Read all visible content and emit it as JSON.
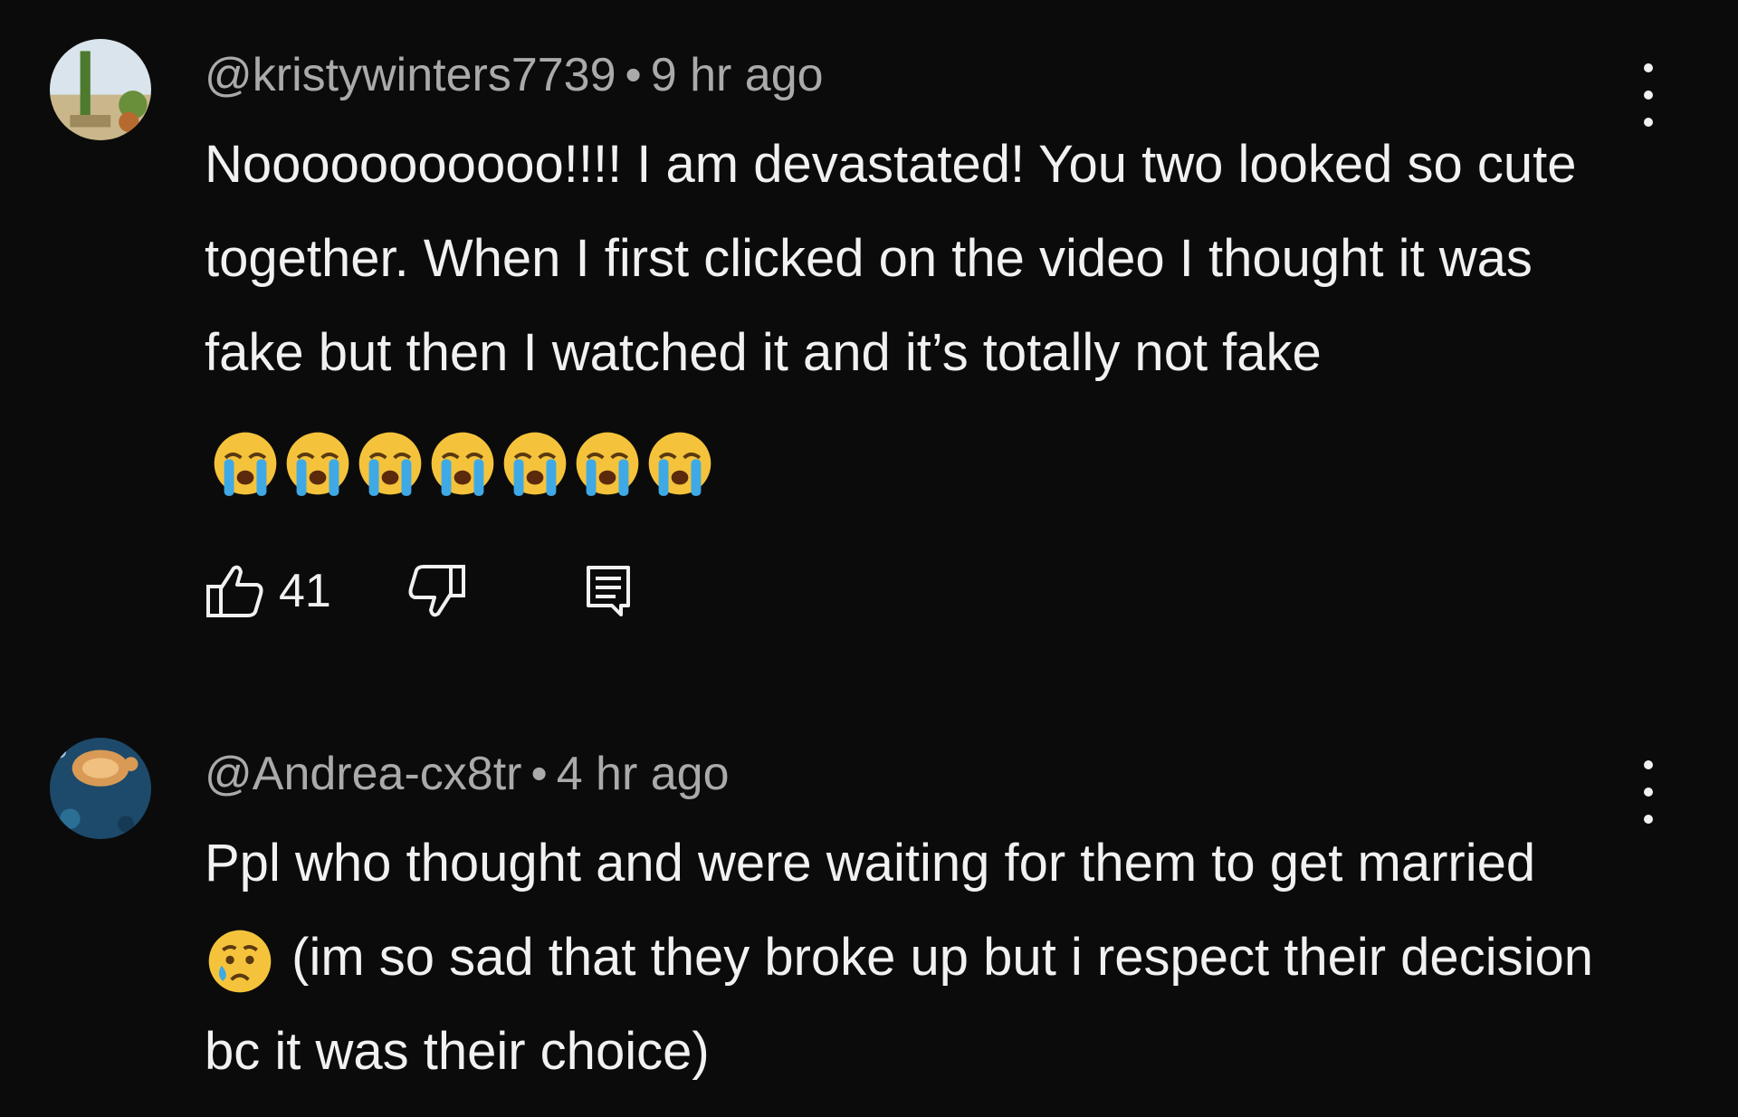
{
  "comments": [
    {
      "author": "@kristywinters7739",
      "separator": "•",
      "time": "9 hr ago",
      "text": "Nooooooooooo!!!! I am devastated! You two looked so cute together. When I first clicked on the video I thought it was fake but then I watched it and it’s totally not fake",
      "emoji": "loudly-crying-face",
      "emoji_count": 7,
      "likes": "41",
      "avatar_icon": "desert-landscape-avatar",
      "menu_icon": "more-vertical-icon"
    },
    {
      "author": "@Andrea-cx8tr",
      "separator": "•",
      "time": "4 hr ago",
      "text_before_emoji": "Ppl who thought and were waiting for them to get married",
      "emoji": "crying-face",
      "text_after_emoji": "(im so sad that they broke up but i respect their decision bc it was their choice)",
      "avatar_icon": "ocean-turtle-avatar",
      "menu_icon": "more-vertical-icon"
    }
  ],
  "icons": {
    "like": "thumb-up-icon",
    "dislike": "thumb-down-icon",
    "reply": "reply-comment-icon"
  },
  "colors": {
    "background": "#0b0b0b",
    "primary_text": "#f1f1f1",
    "secondary_text": "#aaaaaa",
    "emoji_yellow": "#f5c33b",
    "emoji_tears": "#3fa9e6"
  }
}
